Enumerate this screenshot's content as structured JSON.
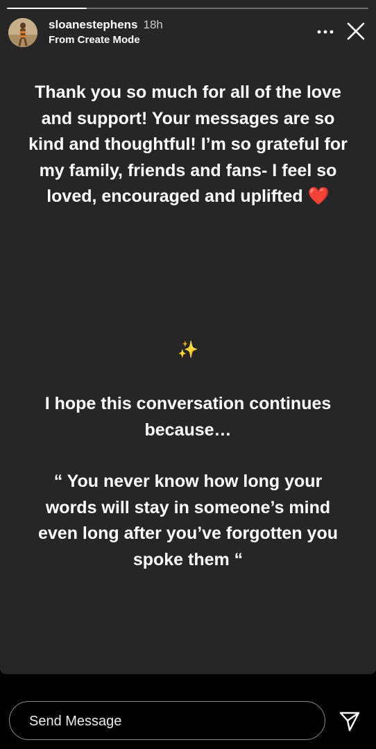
{
  "story": {
    "progress": 0.22,
    "username": "sloanestephens",
    "time_ago": "18h",
    "subtitle": "From Create Mode",
    "paragraph_1": "Thank you so much for all of the love and support! Your messages are so kind and thoughtful! I’m so grateful for my family, friends and fans- I feel so loved, encouraged and uplifted",
    "paragraph_1_emoji": "❤️",
    "sparkle_emoji": "✨",
    "paragraph_2": "I hope this conversation continues because…",
    "paragraph_3": "“ You never know how long your words will stay in someone’s mind even long after you’ve forgotten you spoke them “"
  },
  "composer": {
    "placeholder": "Send Message"
  },
  "icons": {
    "more": "more-options-icon",
    "close": "close-icon",
    "send": "send-icon"
  },
  "colors": {
    "story_bg": "#262626",
    "page_bg": "#000000",
    "heart": "#e0252b"
  }
}
